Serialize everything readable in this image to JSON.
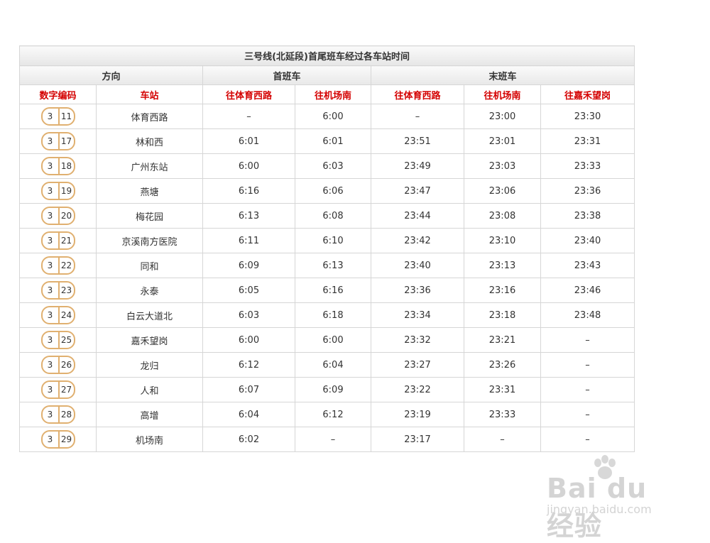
{
  "table": {
    "title": "三号线(北延段)首尾班车经过各车站时间",
    "group_headers": {
      "direction": "方向",
      "first_train": "首班车",
      "last_train": "末班车"
    },
    "sub_headers": {
      "code": "数字编码",
      "station": "车站",
      "first_to_tiyuxilu": "往体育西路",
      "first_to_jichangnan": "往机场南",
      "last_to_tiyuxilu": "往体育西路",
      "last_to_jichangnan": "往机场南",
      "last_to_jiahewanggang": "往嘉禾望岗"
    },
    "rows": [
      {
        "line": "3",
        "num": "11",
        "station": "体育西路",
        "f1": "–",
        "f2": "6:00",
        "l1": "–",
        "l2": "23:00",
        "l3": "23:30"
      },
      {
        "line": "3",
        "num": "17",
        "station": "林和西",
        "f1": "6:01",
        "f2": "6:01",
        "l1": "23:51",
        "l2": "23:01",
        "l3": "23:31"
      },
      {
        "line": "3",
        "num": "18",
        "station": "广州东站",
        "f1": "6:00",
        "f2": "6:03",
        "l1": "23:49",
        "l2": "23:03",
        "l3": "23:33"
      },
      {
        "line": "3",
        "num": "19",
        "station": "燕塘",
        "f1": "6:16",
        "f2": "6:06",
        "l1": "23:47",
        "l2": "23:06",
        "l3": "23:36"
      },
      {
        "line": "3",
        "num": "20",
        "station": "梅花园",
        "f1": "6:13",
        "f2": "6:08",
        "l1": "23:44",
        "l2": "23:08",
        "l3": "23:38"
      },
      {
        "line": "3",
        "num": "21",
        "station": "京溪南方医院",
        "f1": "6:11",
        "f2": "6:10",
        "l1": "23:42",
        "l2": "23:10",
        "l3": "23:40"
      },
      {
        "line": "3",
        "num": "22",
        "station": "同和",
        "f1": "6:09",
        "f2": "6:13",
        "l1": "23:40",
        "l2": "23:13",
        "l3": "23:43"
      },
      {
        "line": "3",
        "num": "23",
        "station": "永泰",
        "f1": "6:05",
        "f2": "6:16",
        "l1": "23:36",
        "l2": "23:16",
        "l3": "23:46"
      },
      {
        "line": "3",
        "num": "24",
        "station": "白云大道北",
        "f1": "6:03",
        "f2": "6:18",
        "l1": "23:34",
        "l2": "23:18",
        "l3": "23:48"
      },
      {
        "line": "3",
        "num": "25",
        "station": "嘉禾望岗",
        "f1": "6:00",
        "f2": "6:00",
        "l1": "23:32",
        "l2": "23:21",
        "l3": "–"
      },
      {
        "line": "3",
        "num": "26",
        "station": "龙归",
        "f1": "6:12",
        "f2": "6:04",
        "l1": "23:27",
        "l2": "23:26",
        "l3": "–"
      },
      {
        "line": "3",
        "num": "27",
        "station": "人和",
        "f1": "6:07",
        "f2": "6:09",
        "l1": "23:22",
        "l2": "23:31",
        "l3": "–"
      },
      {
        "line": "3",
        "num": "28",
        "station": "高增",
        "f1": "6:04",
        "f2": "6:12",
        "l1": "23:19",
        "l2": "23:33",
        "l3": "–"
      },
      {
        "line": "3",
        "num": "29",
        "station": "机场南",
        "f1": "6:02",
        "f2": "–",
        "l1": "23:17",
        "l2": "–",
        "l3": "–"
      }
    ]
  },
  "watermark": {
    "logo": "Bai du 经验",
    "url": "jingyan.baidu.com"
  },
  "colors": {
    "header_red": "#d40000",
    "badge_border": "#e0b070",
    "grid": "#d6d6d6"
  }
}
